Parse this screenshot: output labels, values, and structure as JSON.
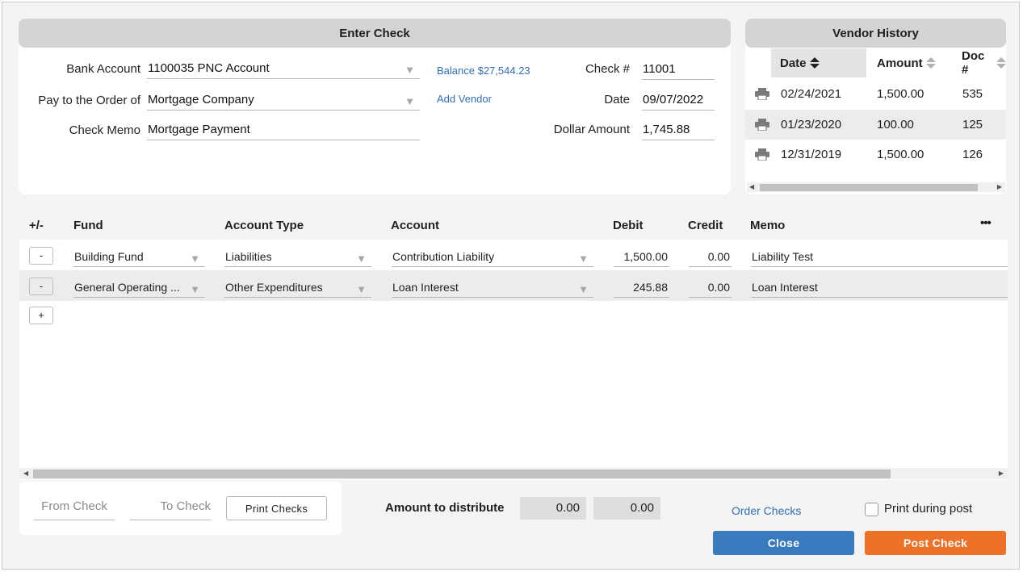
{
  "enter_check": {
    "title": "Enter Check",
    "bank_account_label": "Bank Account",
    "bank_account_value": "1100035 PNC Account",
    "pay_to_label": "Pay to the Order of",
    "pay_to_value": "Mortgage Company",
    "memo_label": "Check Memo",
    "memo_value": "Mortgage Payment",
    "balance_link": "Balance $27,544.23",
    "add_vendor_link": "Add Vendor",
    "check_no_label": "Check #",
    "check_no_value": "11001",
    "date_label": "Date",
    "date_value": "09/07/2022",
    "amount_label": "Dollar Amount",
    "amount_value": "1,745.88"
  },
  "vendor_history": {
    "title": "Vendor History",
    "columns": {
      "date": "Date",
      "amount": "Amount",
      "doc": "Doc #"
    },
    "rows": [
      {
        "date": "02/24/2021",
        "amount": "1,500.00",
        "doc": "535"
      },
      {
        "date": "01/23/2020",
        "amount": "100.00",
        "doc": "125"
      },
      {
        "date": "12/31/2019",
        "amount": "1,500.00",
        "doc": "126"
      }
    ]
  },
  "grid": {
    "headers": {
      "pm": "+/-",
      "fund": "Fund",
      "account_type": "Account Type",
      "account": "Account",
      "debit": "Debit",
      "credit": "Credit",
      "memo": "Memo",
      "more": "•••"
    },
    "rows": [
      {
        "btn": "-",
        "fund": "Building Fund",
        "account_type": "Liabilities",
        "account": "Contribution Liability",
        "debit": "1,500.00",
        "credit": "0.00",
        "memo": "Liability Test"
      },
      {
        "btn": "-",
        "fund": "General Operating ...",
        "account_type": "Other Expenditures",
        "account": "Loan Interest",
        "debit": "245.88",
        "credit": "0.00",
        "memo": "Loan Interest"
      }
    ],
    "add_btn": "+"
  },
  "footer": {
    "from_check_placeholder": "From Check",
    "to_check_placeholder": "To Check",
    "print_checks": "Print Checks",
    "amount_to_distribute_label": "Amount to distribute",
    "distribute_debit": "0.00",
    "distribute_credit": "0.00",
    "order_checks": "Order Checks",
    "print_during_post": "Print during post",
    "close": "Close",
    "post_check": "Post Check"
  },
  "colors": {
    "close_button": "#3a7bbf",
    "post_button": "#ee7128",
    "link": "#2f6fb5"
  }
}
